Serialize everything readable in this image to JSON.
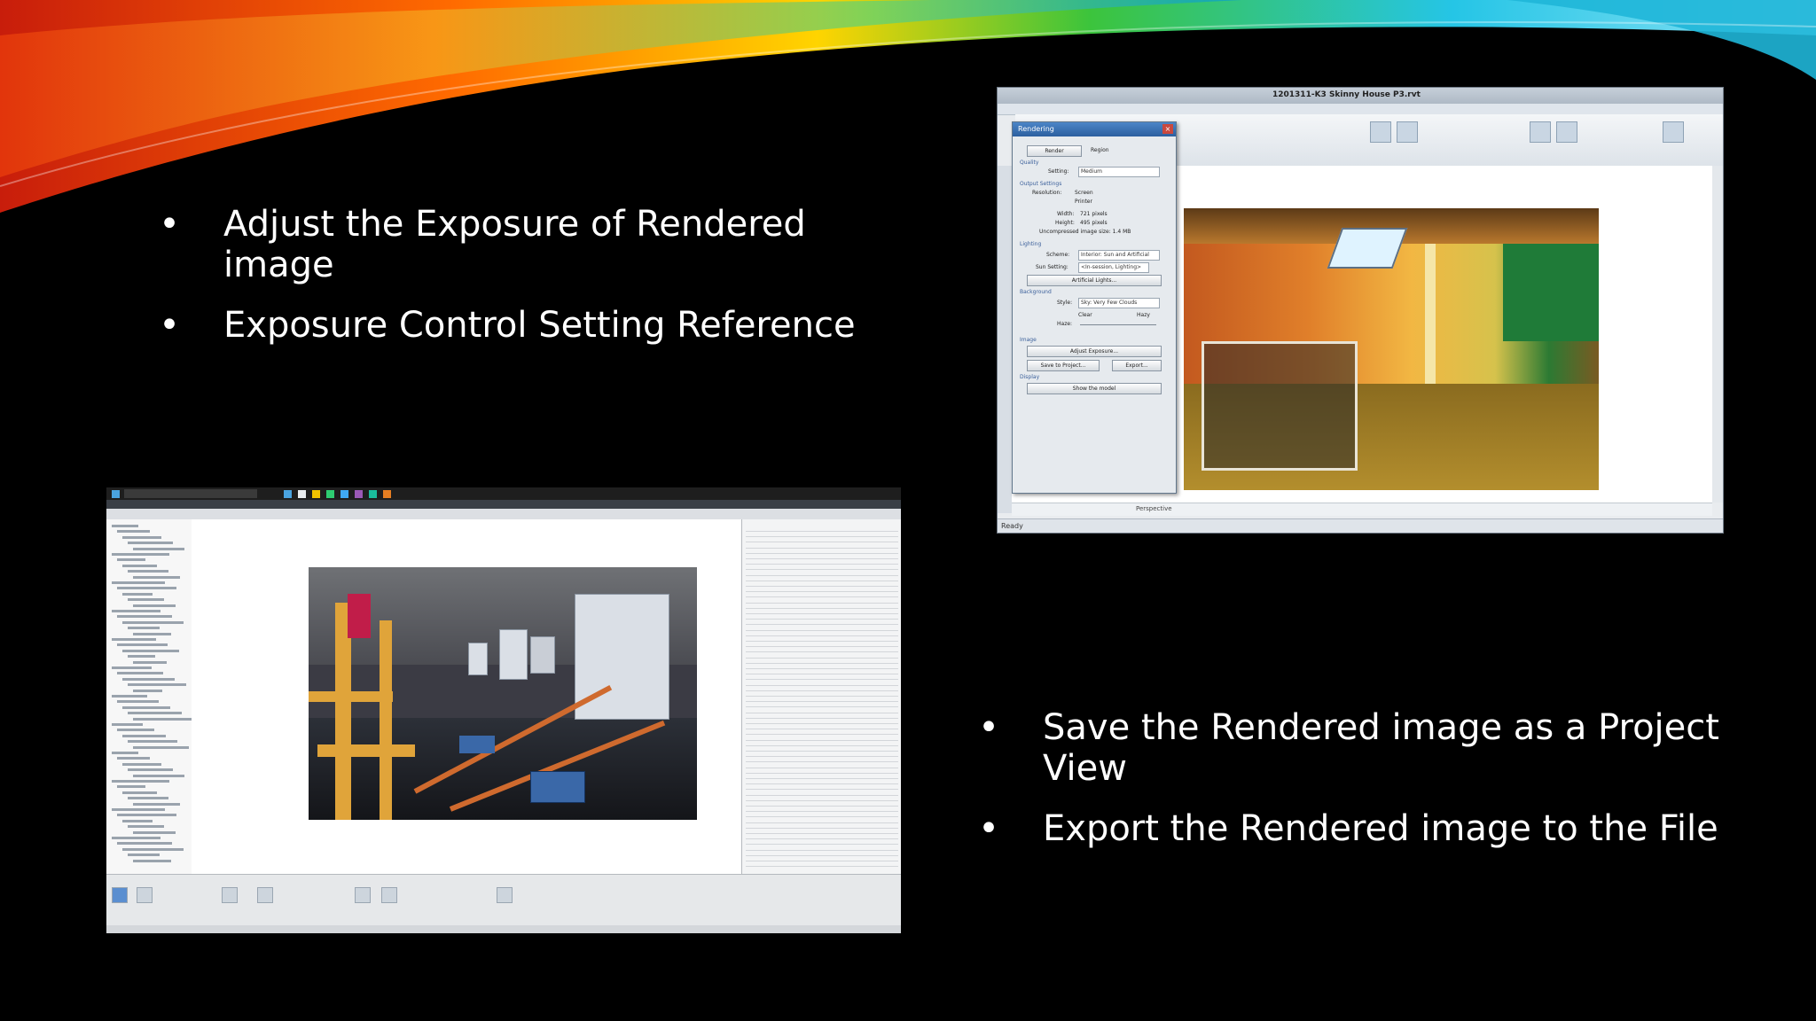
{
  "slide": {
    "background": "#000000",
    "swoosh_colors": [
      "#ff6b00",
      "#ffd400",
      "#3cc43c",
      "#25c5e6",
      "#e11d48"
    ],
    "bullets_top": [
      {
        "marker": "•",
        "text": "Adjust the Exposure of Rendered image"
      },
      {
        "marker": "•",
        "text": "Exposure Control Setting Reference"
      }
    ],
    "bullets_bottom": [
      {
        "marker": "•",
        "text": "Save the Rendered image as a Project View"
      },
      {
        "marker": "•",
        "text": "Export the Rendered image to the File"
      }
    ]
  },
  "screenshot_revit": {
    "title": "1201311-K3 Skinny House P3.rvt",
    "dialog": {
      "title": "Rendering",
      "render_button": "Render",
      "region_label": "Region",
      "quality_label": "Quality",
      "setting_label": "Setting:",
      "setting_value": "Medium",
      "output_label": "Output Settings",
      "resolution_label": "Resolution:",
      "screen_option": "Screen",
      "printer_option": "Printer",
      "width_label": "Width:",
      "width_value": "721 pixels",
      "height_label": "Height:",
      "height_value": "495 pixels",
      "size_label": "Uncompressed image size: 1.4 MB",
      "lighting_label": "Lighting",
      "scheme_label": "Scheme:",
      "scheme_value": "Interior: Sun and Artificial",
      "sun_label": "Sun Setting:",
      "sun_value": "<In-session, Lighting>",
      "artificial_button": "Artificial Lights...",
      "background_label": "Background",
      "style_label": "Style:",
      "style_value": "Sky: Very Few Clouds",
      "clear_label": "Clear",
      "hazy_label": "Hazy",
      "haze_label": "Haze:",
      "image_label": "Image",
      "adjust_button": "Adjust Exposure...",
      "save_button": "Save to Project...",
      "export_button": "Export...",
      "display_label": "Display",
      "show_button": "Show the model"
    },
    "viewbar_label": "Perspective",
    "status_text": "Ready"
  },
  "screenshot_navisworks": {
    "taskbar_icon_colors": [
      "#4aa3df",
      "#e9ecef",
      "#f2c200",
      "#2ecc71",
      "#3fa9f5",
      "#9b59b6",
      "#1abc9c",
      "#e67e22"
    ]
  }
}
